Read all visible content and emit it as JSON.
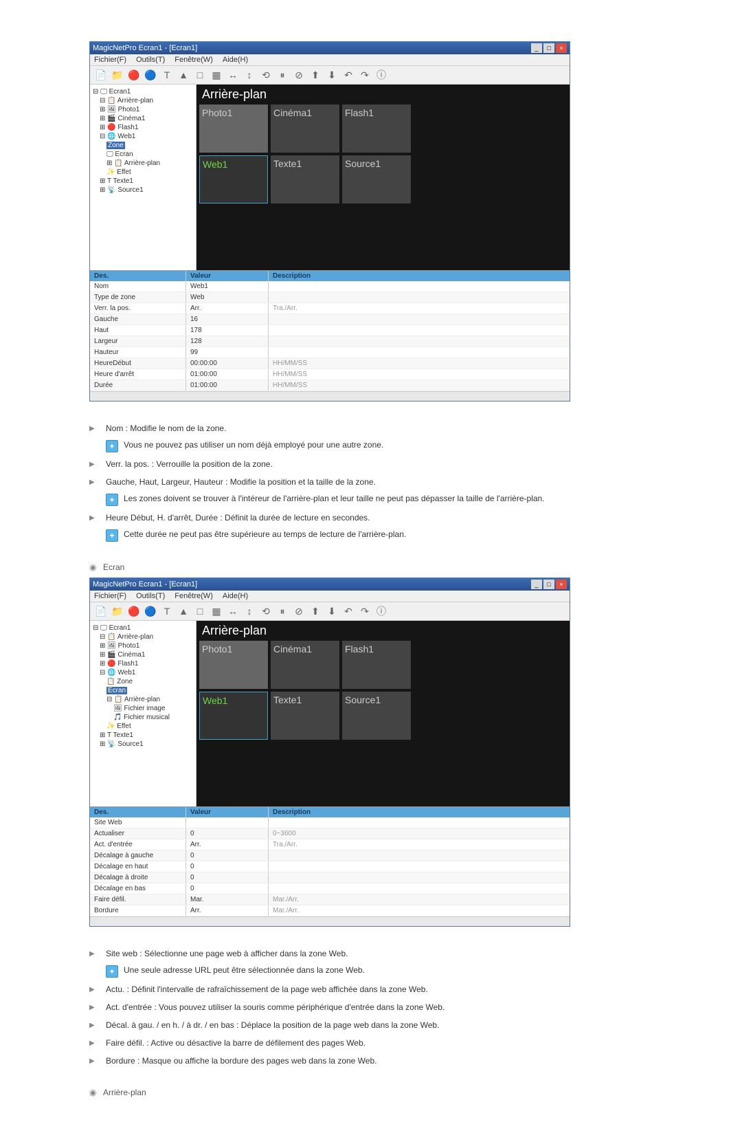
{
  "screenshots": {
    "titlebar_text": "MagicNetPro Ecran1 - [Ecran1]",
    "menu": [
      "Fichier(F)",
      "Outils(T)",
      "Fenêtre(W)",
      "Aide(H)"
    ],
    "canvas_title": "Arrière-plan",
    "zones": [
      "Photo1",
      "Cinéma1",
      "Flash1",
      "Web1",
      "Texte1",
      "Source1"
    ],
    "props_header": {
      "c1": "Des.",
      "c2": "Valeur",
      "c3": "Description"
    }
  },
  "tree_a": [
    "Ecran1",
    "Arrière-plan",
    "Photo1",
    "Cinéma1",
    "Flash1",
    "Web1",
    "Zone",
    "Ecran",
    "Arrière-plan",
    "Effet",
    "Texte1",
    "Source1"
  ],
  "props_a": [
    {
      "name": "Nom",
      "val": "Web1",
      "desc": ""
    },
    {
      "name": "Type de zone",
      "val": "Web",
      "desc": ""
    },
    {
      "name": "Verr. la pos.",
      "val": "Arr.",
      "desc": "Tra./Arr."
    },
    {
      "name": "Gauche",
      "val": "16",
      "desc": ""
    },
    {
      "name": "Haut",
      "val": "178",
      "desc": ""
    },
    {
      "name": "Largeur",
      "val": "128",
      "desc": ""
    },
    {
      "name": "Hauteur",
      "val": "99",
      "desc": ""
    },
    {
      "name": "HeureDébut",
      "val": "00:00:00",
      "desc": "HH/MM/SS"
    },
    {
      "name": "Heure d'arrêt",
      "val": "01:00:00",
      "desc": "HH/MM/SS"
    },
    {
      "name": "Durée",
      "val": "01:00:00",
      "desc": "HH/MM/SS"
    }
  ],
  "tree_b": [
    "Ecran1",
    "Arrière-plan",
    "Photo1",
    "Cinéma1",
    "Flash1",
    "Web1",
    "Zone",
    "Ecran",
    "Arrière-plan",
    "Fichier image",
    "Fichier musical",
    "Effet",
    "Texte1",
    "Source1"
  ],
  "props_b": [
    {
      "name": "Des.",
      "val": "Valeur",
      "desc": "Description"
    },
    {
      "name": "Site Web",
      "val": "",
      "desc": ""
    },
    {
      "name": "Actualiser",
      "val": "0",
      "desc": "0~3600"
    },
    {
      "name": "Act. d'entrée",
      "val": "Arr.",
      "desc": "Tra./Arr."
    },
    {
      "name": "Décalage à gauche",
      "val": "0",
      "desc": ""
    },
    {
      "name": "Décalage en haut",
      "val": "0",
      "desc": ""
    },
    {
      "name": "Décalage à droite",
      "val": "0",
      "desc": ""
    },
    {
      "name": "Décalage en bas",
      "val": "0",
      "desc": ""
    },
    {
      "name": "Faire défil.",
      "val": "Mar.",
      "desc": "Mar./Arr."
    },
    {
      "name": "Bordure",
      "val": "Arr.",
      "desc": "Mar./Arr."
    }
  ],
  "doc_a": {
    "i1": "Nom : Modifie le nom de la zone.",
    "i1_sub": "Vous ne pouvez pas utiliser un nom déjà employé pour une autre zone.",
    "i2": "Verr. la pos. : Verrouille la position de la zone.",
    "i3": "Gauche, Haut, Largeur, Hauteur : Modifie la position et la taille de la zone.",
    "i3_sub": "Les zones doivent se trouver à l'intéreur de l'arrière-plan et leur taille ne peut pas dépasser la taille de l'arrière-plan.",
    "i4": "Heure Début, H. d'arrêt, Durée : Définit la durée de lecture en secondes.",
    "i4_sub": "Cette durée ne peut pas être supérieure au temps de lecture de l'arrière-plan."
  },
  "section_b_title": "Ecran",
  "doc_b": {
    "i1": "Site web : Sélectionne une page web à afficher dans la zone Web.",
    "i1_sub": "Une seule adresse URL peut être sélectionnée dans la zone Web.",
    "i2": "Actu. : Définit l'intervalle de rafraîchissement de la page web affichée dans la zone Web.",
    "i3": "Act. d'entrée : Vous pouvez utiliser la souris comme périphérique d'entrée dans la zone Web.",
    "i4": "Décal. à gau. / en h. / à dr. / en bas : Déplace la position de la page web dans la zone Web.",
    "i5": "Faire défil. : Active ou désactive la barre de défilement des pages Web.",
    "i6": "Bordure : Masque ou affiche la bordure des pages web dans la zone Web."
  },
  "footer_title": "Arrière-plan"
}
